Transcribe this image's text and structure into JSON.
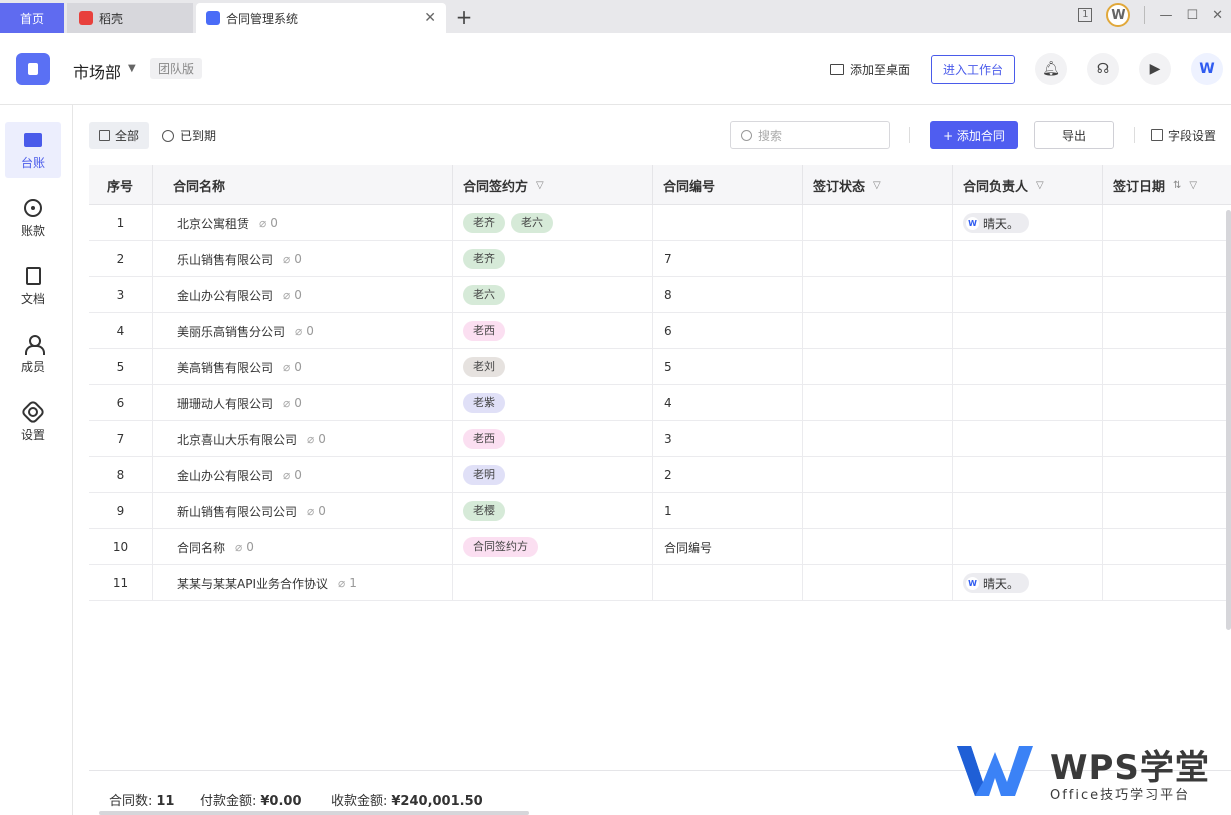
{
  "tabs": {
    "home": "首页",
    "daoke": "稻壳",
    "contract": "合同管理系统"
  },
  "window": {
    "layout_label": "1"
  },
  "header": {
    "department": "市场部",
    "edition": "团队版",
    "add_desktop": "添加至桌面",
    "workbench": "进入工作台",
    "wps_mark": "W"
  },
  "nav": [
    {
      "label": "台账"
    },
    {
      "label": "账款"
    },
    {
      "label": "文档"
    },
    {
      "label": "成员"
    },
    {
      "label": "设置"
    }
  ],
  "toolbar": {
    "all": "全部",
    "expired": "已到期",
    "search_placeholder": "搜索",
    "add": "+ 添加合同",
    "export": "导出",
    "field_settings": "字段设置"
  },
  "table": {
    "headers": [
      "序号",
      "合同名称",
      "合同签约方",
      "合同编号",
      "签订状态",
      "合同负责人",
      "签订日期"
    ],
    "rows": [
      {
        "idx": "1",
        "name": "北京公寓租赁",
        "att": "0",
        "parties": [
          "老齐",
          "老六"
        ],
        "no": "",
        "owner": "晴天。"
      },
      {
        "idx": "2",
        "name": "乐山销售有限公司",
        "att": "0",
        "parties": [
          "老齐"
        ],
        "no": "7",
        "owner": ""
      },
      {
        "idx": "3",
        "name": "金山办公有限公司",
        "att": "0",
        "parties": [
          "老六"
        ],
        "no": "8",
        "owner": ""
      },
      {
        "idx": "4",
        "name": "美丽乐高销售分公司",
        "att": "0",
        "parties": [
          "老西"
        ],
        "no": "6",
        "owner": ""
      },
      {
        "idx": "5",
        "name": "美高销售有限公司",
        "att": "0",
        "parties": [
          "老刘"
        ],
        "no": "5",
        "owner": ""
      },
      {
        "idx": "6",
        "name": "珊珊动人有限公司",
        "att": "0",
        "parties": [
          "老紫"
        ],
        "no": "4",
        "owner": ""
      },
      {
        "idx": "7",
        "name": "北京喜山大乐有限公司",
        "att": "0",
        "parties": [
          "老西"
        ],
        "no": "3",
        "owner": ""
      },
      {
        "idx": "8",
        "name": "金山办公有限公司",
        "att": "0",
        "parties": [
          "老明"
        ],
        "no": "2",
        "owner": ""
      },
      {
        "idx": "9",
        "name": "新山销售有限公司公司",
        "att": "0",
        "parties": [
          "老樱"
        ],
        "no": "1",
        "owner": ""
      },
      {
        "idx": "10",
        "name": "合同名称",
        "att": "0",
        "parties": [
          "合同签约方"
        ],
        "no": "合同编号",
        "owner": ""
      },
      {
        "idx": "11",
        "name": "某某与某某API业务合作协议",
        "att": "1",
        "parties": [],
        "no": "",
        "owner": "晴天。"
      }
    ],
    "tag_colors": {
      "老齐": "#d6ead8",
      "老六": "#d6ead8",
      "老西": "#fbdff1",
      "老刘": "#e6e2df",
      "老紫": "#e0e0f7",
      "老明": "#e0e0f7",
      "老樱": "#d6ead8",
      "合同签约方": "#fbdff1"
    }
  },
  "footer": {
    "count_label": "合同数:",
    "count": "11",
    "pay_label": "付款金额:",
    "pay": "¥0.00",
    "recv_label": "收款金额:",
    "recv": "¥240,001.50"
  },
  "watermark": {
    "title": "WPS学堂",
    "subtitle": "Office技巧学习平台"
  }
}
